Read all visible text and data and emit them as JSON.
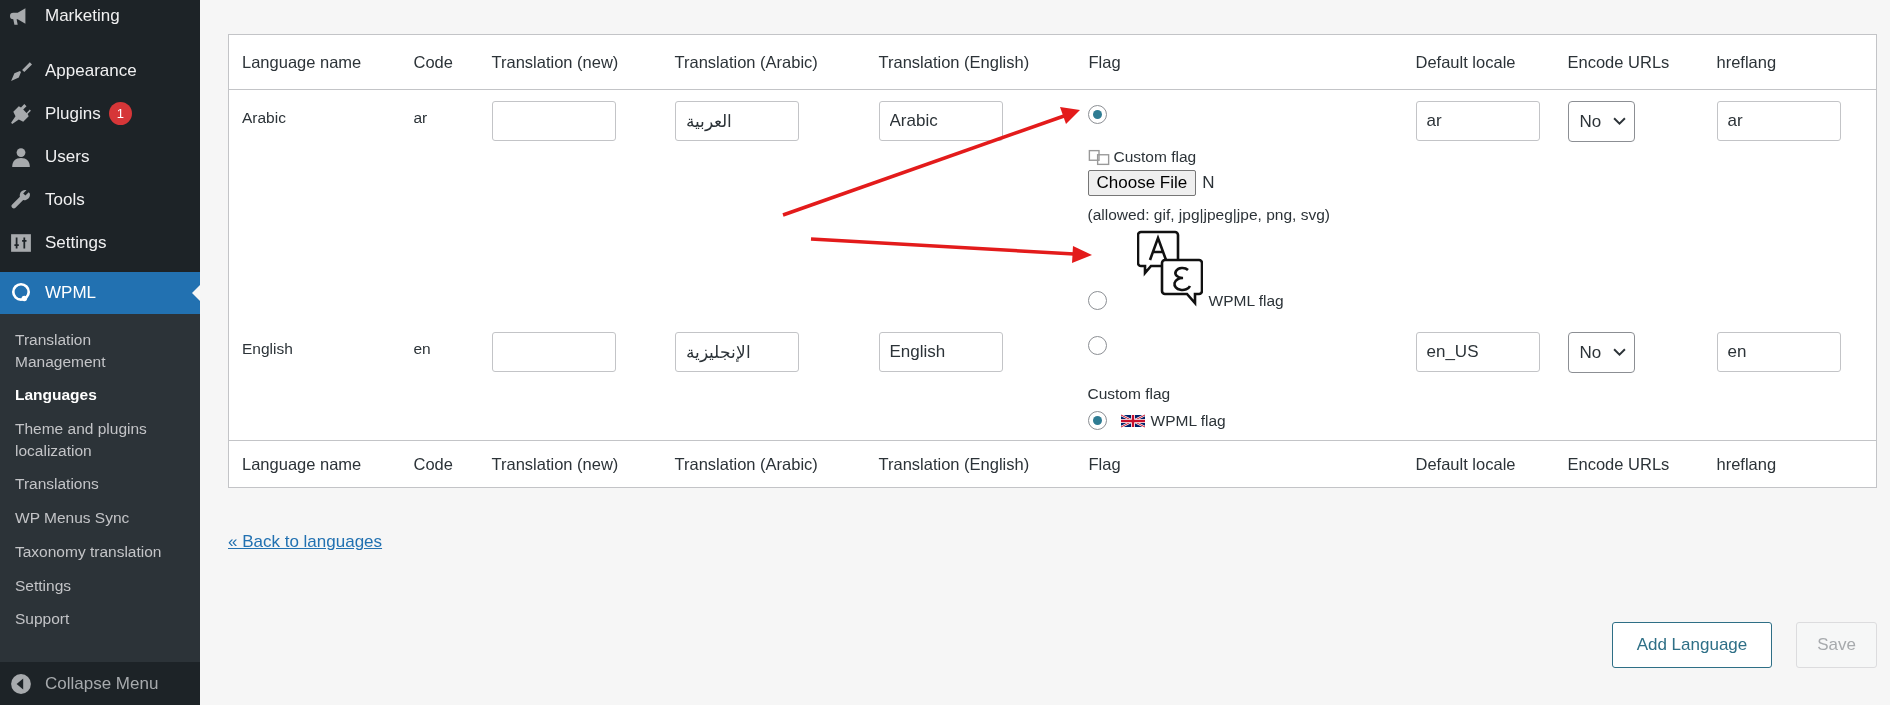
{
  "sidebar": {
    "items": [
      {
        "label": "Marketing",
        "selected": false
      },
      {
        "label": "Appearance",
        "selected": false
      },
      {
        "label": "Plugins",
        "badge": "1",
        "selected": false
      },
      {
        "label": "Users",
        "selected": false
      },
      {
        "label": "Tools",
        "selected": false
      },
      {
        "label": "Settings",
        "selected": false
      },
      {
        "label": "WPML",
        "selected": true
      }
    ],
    "submenu": [
      {
        "label": "Translation Management",
        "selected": false
      },
      {
        "label": "Languages",
        "selected": true
      },
      {
        "label": "Theme and plugins localization",
        "selected": false
      },
      {
        "label": "Translations",
        "selected": false
      },
      {
        "label": "WP Menus Sync",
        "selected": false
      },
      {
        "label": "Taxonomy translation",
        "selected": false
      },
      {
        "label": "Settings",
        "selected": false
      },
      {
        "label": "Support",
        "selected": false
      }
    ],
    "collapse": "Collapse Menu"
  },
  "table": {
    "columns": [
      "Language name",
      "Code",
      "Translation (new)",
      "Translation (Arabic)",
      "Translation (English)",
      "Flag",
      "Default locale",
      "Encode URLs",
      "hreflang"
    ],
    "rows": [
      {
        "name": "Arabic",
        "code": "ar",
        "translation_arabic": "العربية",
        "translation_english": "Arabic",
        "flag": {
          "custom": {
            "selected": true,
            "label": "Custom flag",
            "file_button": "Choose File",
            "file_status": "N",
            "allowed": "(allowed: gif, jpg|jpeg|jpe, png, svg)"
          },
          "wpml": {
            "selected": false,
            "label": "WPML flag",
            "kind": "language"
          }
        },
        "default_locale": "ar",
        "encode_urls": "No",
        "hreflang": "ar"
      },
      {
        "name": "English",
        "code": "en",
        "translation_arabic": "الإنجليزية",
        "translation_english": "English",
        "flag": {
          "custom": {
            "selected": false,
            "label": "Custom flag"
          },
          "wpml": {
            "selected": true,
            "label": "WPML flag",
            "kind": "uk"
          }
        },
        "default_locale": "en_US",
        "encode_urls": "No",
        "hreflang": "en"
      }
    ],
    "footer_columns": [
      "Language name",
      "Code",
      "Translation (new)",
      "Translation (Arabic)",
      "Translation (English)",
      "Flag",
      "Default locale",
      "Encode URLs",
      "hreflang"
    ]
  },
  "back_link": "« Back to languages",
  "buttons": [
    {
      "label": "Add Language",
      "disabled": false
    },
    {
      "label": "Save",
      "disabled": true
    }
  ]
}
